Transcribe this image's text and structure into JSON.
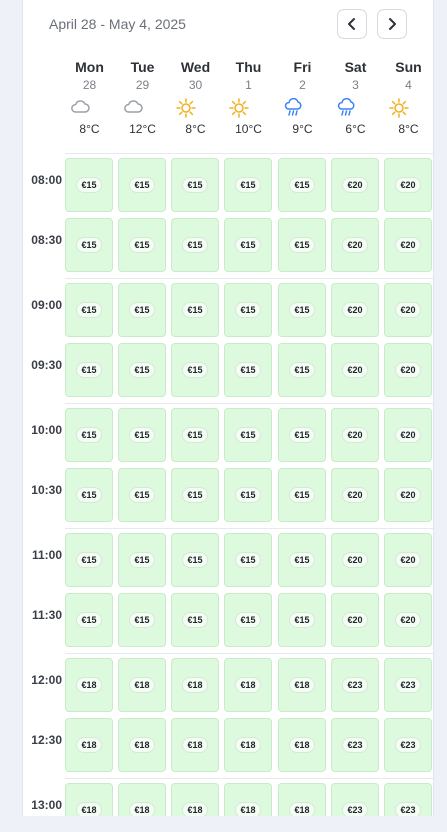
{
  "header": {
    "date_range": "April 28 - May 4, 2025"
  },
  "days": [
    {
      "name": "Mon",
      "date": "28",
      "weather": "cloud-icon",
      "temp": "8°C"
    },
    {
      "name": "Tue",
      "date": "29",
      "weather": "cloud-icon",
      "temp": "12°C"
    },
    {
      "name": "Wed",
      "date": "30",
      "weather": "sun-icon",
      "temp": "8°C"
    },
    {
      "name": "Thu",
      "date": "1",
      "weather": "sun-icon",
      "temp": "10°C"
    },
    {
      "name": "Fri",
      "date": "2",
      "weather": "rain-icon",
      "temp": "9°C"
    },
    {
      "name": "Sat",
      "date": "3",
      "weather": "rain-icon",
      "temp": "6°C"
    },
    {
      "name": "Sun",
      "date": "4",
      "weather": "sun-icon",
      "temp": "8°C"
    }
  ],
  "slots": [
    {
      "time": "08:00",
      "prices": [
        "€15",
        "€15",
        "€15",
        "€15",
        "€15",
        "€20",
        "€20"
      ]
    },
    {
      "time": "08:30",
      "prices": [
        "€15",
        "€15",
        "€15",
        "€15",
        "€15",
        "€20",
        "€20"
      ]
    },
    {
      "time": "09:00",
      "prices": [
        "€15",
        "€15",
        "€15",
        "€15",
        "€15",
        "€20",
        "€20"
      ]
    },
    {
      "time": "09:30",
      "prices": [
        "€15",
        "€15",
        "€15",
        "€15",
        "€15",
        "€20",
        "€20"
      ]
    },
    {
      "time": "10:00",
      "prices": [
        "€15",
        "€15",
        "€15",
        "€15",
        "€15",
        "€20",
        "€20"
      ]
    },
    {
      "time": "10:30",
      "prices": [
        "€15",
        "€15",
        "€15",
        "€15",
        "€15",
        "€20",
        "€20"
      ]
    },
    {
      "time": "11:00",
      "prices": [
        "€15",
        "€15",
        "€15",
        "€15",
        "€15",
        "€20",
        "€20"
      ]
    },
    {
      "time": "11:30",
      "prices": [
        "€15",
        "€15",
        "€15",
        "€15",
        "€15",
        "€20",
        "€20"
      ]
    },
    {
      "time": "12:00",
      "prices": [
        "€18",
        "€18",
        "€18",
        "€18",
        "€18",
        "€23",
        "€23"
      ]
    },
    {
      "time": "12:30",
      "prices": [
        "€18",
        "€18",
        "€18",
        "€18",
        "€18",
        "€23",
        "€23"
      ]
    },
    {
      "time": "13:00",
      "prices": [
        "€18",
        "€18",
        "€18",
        "€18",
        "€18",
        "€23",
        "€23"
      ]
    }
  ],
  "colors": {
    "slot_available": "#defade",
    "sun": "#f2b01e",
    "rain": "#3b82f6",
    "cloud": "#9aa0a8"
  }
}
